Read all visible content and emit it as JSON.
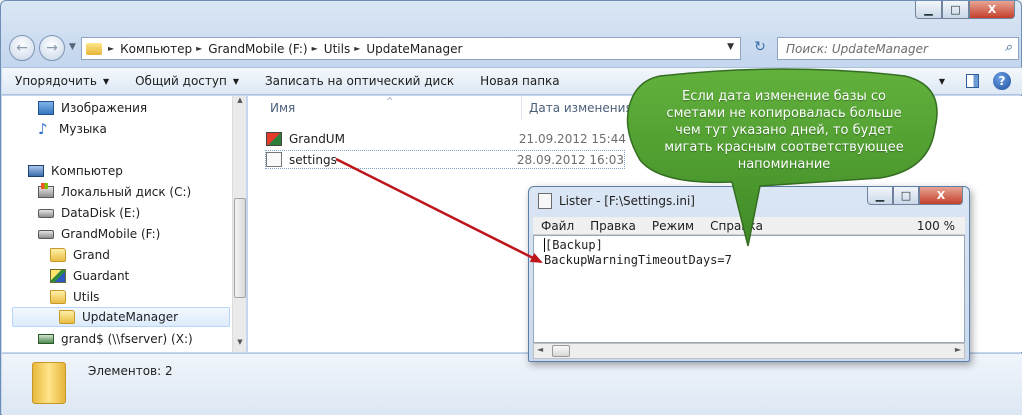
{
  "explorer": {
    "caption_buttons": {
      "minimize": "▁",
      "maximize": "□",
      "close": "X"
    },
    "nav": {
      "back_icon": "←",
      "forward_icon": "→",
      "dropdown_icon": "▼",
      "breadcrumbs": [
        "Компьютер",
        "GrandMobile (F:)",
        "Utils",
        "UpdateManager"
      ],
      "refresh_icon": "↻",
      "search_placeholder": "Поиск: UpdateManager",
      "search_icon": "⌕"
    },
    "toolbar": {
      "items": [
        "Упорядочить",
        "Общий доступ",
        "Записать на оптический диск",
        "Новая папка"
      ],
      "dropdown_arrow": "▼",
      "help_icon": "?"
    },
    "navpane": {
      "items": [
        {
          "label": "Изображения",
          "icon": "pictures-icon"
        },
        {
          "label": "Музыка",
          "icon": "music-icon"
        },
        {
          "label": "Компьютер",
          "icon": "computer-icon"
        },
        {
          "label": "Локальный диск (C:)",
          "icon": "system-drive-icon"
        },
        {
          "label": "DataDisk (E:)",
          "icon": "drive-icon"
        },
        {
          "label": "GrandMobile (F:)",
          "icon": "drive-icon"
        },
        {
          "label": "Grand",
          "icon": "folder-icon"
        },
        {
          "label": "Guardant",
          "icon": "guardant-folder-icon"
        },
        {
          "label": "Utils",
          "icon": "folder-icon"
        },
        {
          "label": "UpdateManager",
          "icon": "folder-icon",
          "selected": true
        },
        {
          "label": "grand$ (\\\\fserver) (X:)",
          "icon": "network-drive-icon"
        }
      ],
      "scroll_up": "▲",
      "scroll_down": "▼"
    },
    "filelist": {
      "columns": {
        "name": "Имя",
        "date": "Дата изменения"
      },
      "sort_indicator": "^",
      "rows": [
        {
          "name": "GrandUM",
          "date": "21.09.2012 15:44",
          "icon": "exe-icon"
        },
        {
          "name": "settings",
          "date": "28.09.2012 16:03",
          "icon": "ini-file-icon"
        }
      ]
    },
    "status": {
      "text": "Элементов: 2"
    }
  },
  "lister": {
    "title": "Lister - [F:\\Settings.ini]",
    "menu": [
      "Файл",
      "Правка",
      "Режим",
      "Справка"
    ],
    "zoom": "100 %",
    "content_lines": [
      "[Backup]",
      "BackupWarningTimeoutDays=7"
    ],
    "buttons": {
      "minimize": "▁",
      "maximize": "□",
      "close": "X"
    },
    "scroll_left": "◄",
    "scroll_right": "►"
  },
  "callout": {
    "text": "Если дата изменение базы со\nсметами не копировалась больше\nчем тут указано дней, то будет\nмигать красным соответствующее\nнапоминание",
    "fill": "#4e9c30",
    "arrow_color": "#c0141b"
  }
}
